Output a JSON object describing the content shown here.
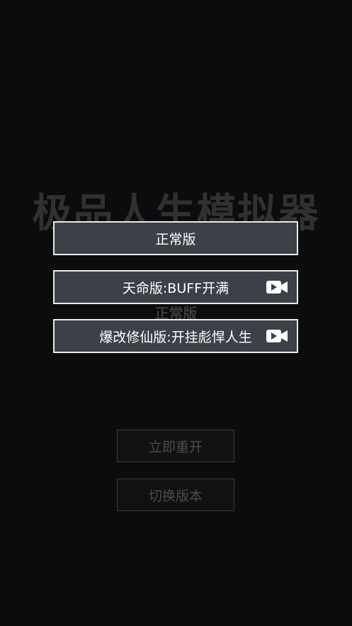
{
  "background": {
    "title": "极品人生模拟器",
    "current_version": "正常版",
    "restart_button": "立即重开",
    "switch_version_button": "切换版本"
  },
  "version_picker": {
    "options": [
      {
        "label": "正常版",
        "requires_video": false
      },
      {
        "label": "天命版:BUFF开满",
        "requires_video": true,
        "icon": "video-camera-icon"
      },
      {
        "label": "爆改修仙版:开挂彪悍人生",
        "requires_video": true,
        "icon": "video-camera-icon"
      }
    ]
  },
  "colors": {
    "background": "#0b0c0d",
    "option_fill": "#3d4047",
    "option_border": "#e9eaec",
    "dim_text": "#2f3132"
  }
}
